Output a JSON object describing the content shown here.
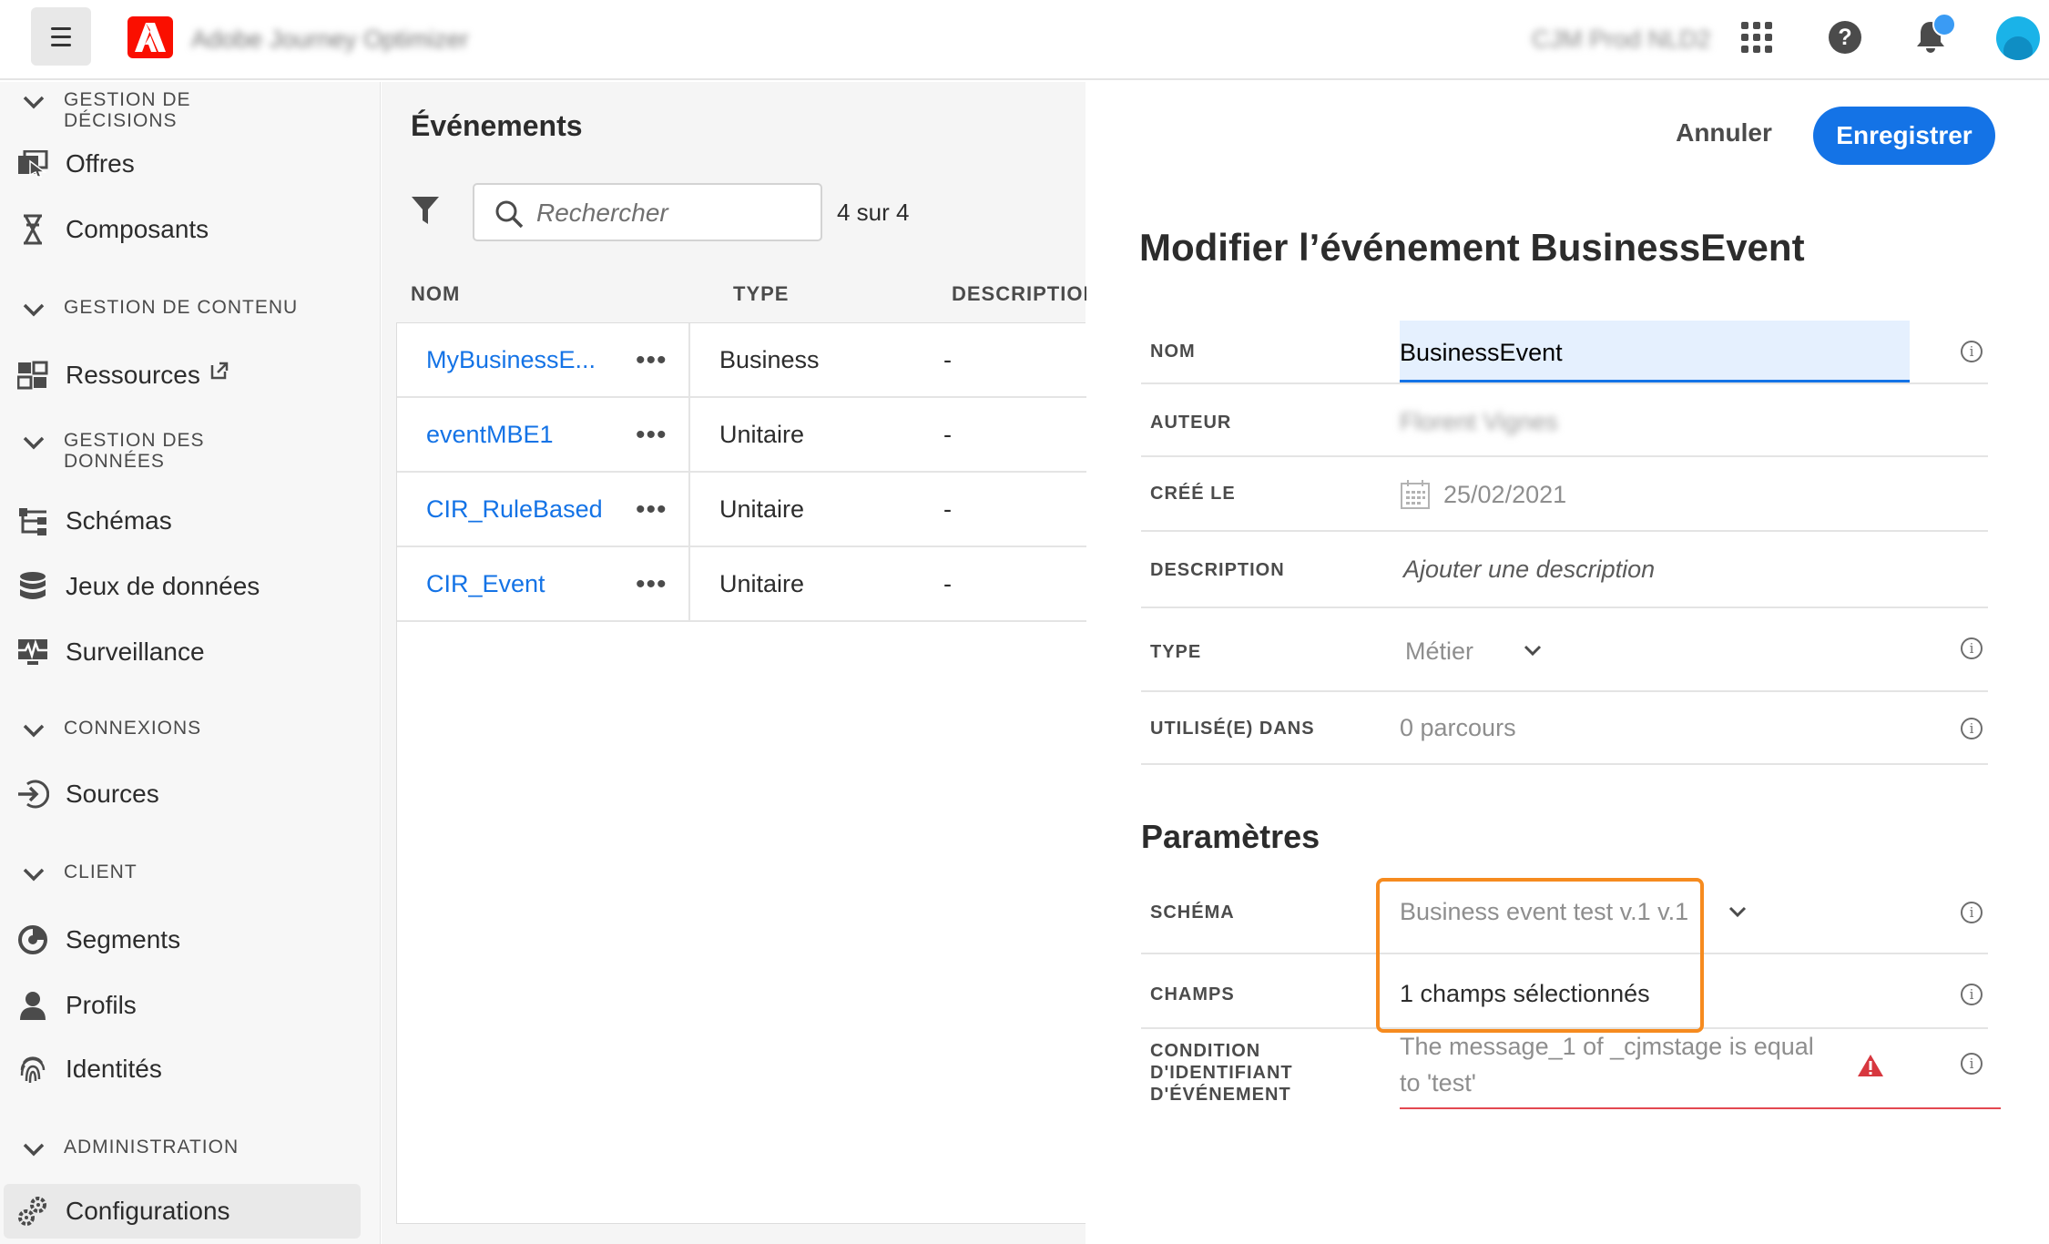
{
  "topbar": {
    "app_title": "Adobe Journey Optimizer",
    "org_name": "CJM Prod NLD2"
  },
  "sidebar": {
    "sections": [
      {
        "label": "GESTION DE\nDÉCISIONS"
      },
      {
        "label": "GESTION DE CONTENU"
      },
      {
        "label": "GESTION DES\nDONNÉES"
      },
      {
        "label": "CONNEXIONS"
      },
      {
        "label": "CLIENT"
      },
      {
        "label": "ADMINISTRATION"
      }
    ],
    "items": [
      {
        "label": "Offres"
      },
      {
        "label": "Composants"
      },
      {
        "label": "Ressources"
      },
      {
        "label": "Schémas"
      },
      {
        "label": "Jeux de données"
      },
      {
        "label": "Surveillance"
      },
      {
        "label": "Sources"
      },
      {
        "label": "Segments"
      },
      {
        "label": "Profils"
      },
      {
        "label": "Identités"
      },
      {
        "label": "Configurations"
      }
    ]
  },
  "events_panel": {
    "title": "Événements",
    "search_placeholder": "Rechercher",
    "count": "4 sur 4",
    "columns": [
      "NOM",
      "TYPE",
      "DESCRIPTION"
    ],
    "rows": [
      {
        "name": "MyBusinessE...",
        "more": "•••",
        "type": "Business",
        "description": "-"
      },
      {
        "name": "eventMBE1",
        "more": "•••",
        "type": "Unitaire",
        "description": "-"
      },
      {
        "name": "CIR_RuleBased",
        "more": "•••",
        "type": "Unitaire",
        "description": "-"
      },
      {
        "name": "CIR_Event",
        "more": "•••",
        "type": "Unitaire",
        "description": "-"
      }
    ]
  },
  "editor": {
    "cancel_label": "Annuler",
    "save_label": "Enregistrer",
    "title": "Modifier l’événement BusinessEvent",
    "fields": {
      "name_label": "NOM",
      "name_value": "BusinessEvent",
      "author_label": "AUTEUR",
      "author_value": "Florent Vignes",
      "created_label": "CRÉÉ LE",
      "created_value": "25/02/2021",
      "description_label": "DESCRIPTION",
      "description_placeholder": "Ajouter une description",
      "type_label": "TYPE",
      "type_value": "Métier",
      "used_in_label": "UTILISÉ(E) DANS",
      "used_in_value": "0 parcours"
    },
    "params_title": "Paramètres",
    "params": {
      "schema_label": "SCHÉMA",
      "schema_value": "Business event test v.1 v.1",
      "fields_label": "CHAMPS",
      "fields_value": "1 champs sélectionnés",
      "condition_label": "CONDITION\nD'IDENTIFIANT\nD'ÉVÉNEMENT",
      "condition_value_line1": "The message_1 of _cjmstage is equal",
      "condition_value_line2": "to 'test'"
    },
    "colors": {
      "accent": "#1473e6",
      "highlight": "#f68b1f",
      "error": "#e34850"
    }
  }
}
